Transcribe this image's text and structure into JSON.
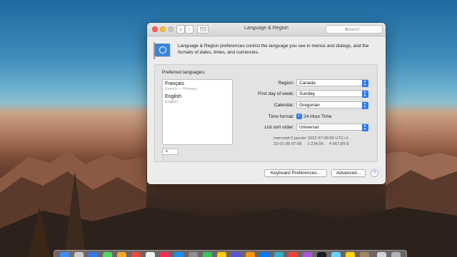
{
  "window": {
    "title": "Language & Region",
    "search_placeholder": "Search",
    "nav_back": "‹",
    "nav_forward": "›",
    "grid_glyph": "⠿⠿"
  },
  "description": "Language & Region preferences control the language you see in menus and dialogs, and the formats of dates, times, and currencies.",
  "preferred_languages": {
    "label": "Preferred languages:",
    "items": [
      {
        "name": "Français",
        "sub": "French — Primary"
      },
      {
        "name": "English",
        "sub": "English"
      }
    ],
    "add_label": "+",
    "remove_label": "−"
  },
  "settings": {
    "region_label": "Region:",
    "region_value": "Canada",
    "first_day_label": "First day of week:",
    "first_day_value": "Sunday",
    "calendar_label": "Calendar:",
    "calendar_value": "Gregorian",
    "time_format_label": "Time format:",
    "time_format_value": "24-Hour Time",
    "time_format_checked": true,
    "sort_label": "List sort order:",
    "sort_value": "Universal"
  },
  "sample": {
    "line1": "mercredi 5 janvier 2022 07:08:09 UTC+1",
    "line2": "22-01-05 07:08     1 234,56     4 567,89 $"
  },
  "buttons": {
    "keyboard": "Keyboard Preferences...",
    "advanced": "Advanced...",
    "help": "?"
  },
  "colors": {
    "accent": "#2d7bf2",
    "window_bg": "#ececec"
  }
}
